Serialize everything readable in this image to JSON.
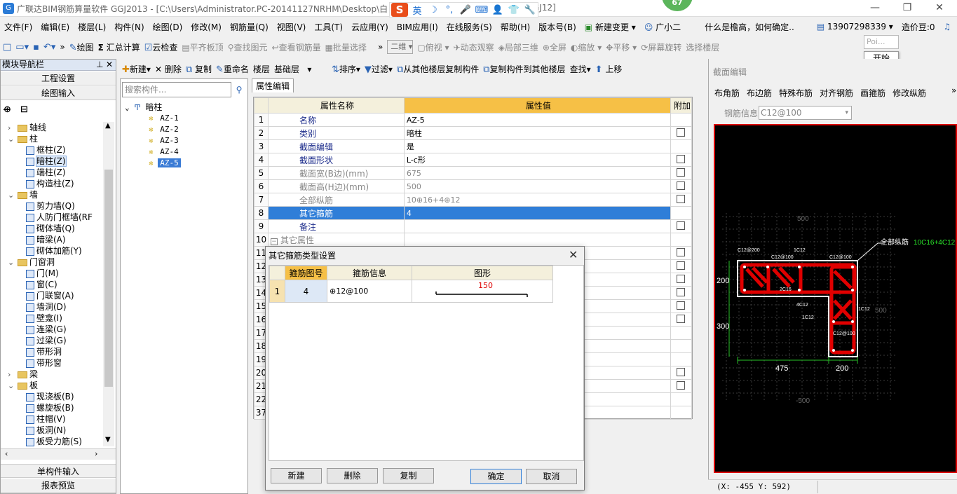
{
  "window": {
    "title": "广联达BIM钢筋算量软件 GGJ2013 - [C:\\Users\\Administrator.PC-20141127NRHM\\Desktop\\白",
    "title_suffix": "GJ12]",
    "badge": "67",
    "minimize": "—",
    "maximize": "❐",
    "close": "✕"
  },
  "ime": {
    "logo": "S",
    "mode": "英",
    "icons": [
      "☽",
      "°,",
      "🎤",
      "⌨",
      "👤",
      "👕",
      "🔧"
    ]
  },
  "menu": {
    "items": [
      "文件(F)",
      "编辑(E)",
      "楼层(L)",
      "构件(N)",
      "绘图(D)",
      "修改(M)",
      "钢筋量(Q)",
      "视图(V)",
      "工具(T)",
      "云应用(Y)",
      "BIM应用(I)",
      "在线服务(S)",
      "帮助(H)",
      "版本号(B)"
    ],
    "change": "新建变更",
    "assistant": "广小二",
    "question": "什么是檐高，如何确定..",
    "phone": "13907298339",
    "coin": "造价豆:0"
  },
  "toolbar": {
    "items": [
      "绘图",
      "汇总计算",
      "云检查",
      "平齐板顶",
      "查找图元",
      "查看钢筋量",
      "批量选择"
    ],
    "view_mode": "二维",
    "right_items": [
      "俯视",
      "动态观察",
      "局部三维",
      "全屏",
      "缩放",
      "平移",
      "屏幕旋转",
      "选择楼层"
    ],
    "popup_top": "Poi...",
    "popup": "开始"
  },
  "nav": {
    "header": "模块导航栏",
    "buttons": [
      "工程设置",
      "绘图输入"
    ],
    "bottom_buttons": [
      "单构件输入",
      "报表预览"
    ],
    "tree": [
      {
        "label": "轴线",
        "level": 1,
        "type": "folder",
        "exp": "›"
      },
      {
        "label": "柱",
        "level": 1,
        "type": "folder",
        "exp": "⌄"
      },
      {
        "label": "框柱(Z)",
        "level": 2,
        "type": "leaf"
      },
      {
        "label": "暗柱(Z)",
        "level": 2,
        "type": "leaf",
        "selected": true
      },
      {
        "label": "端柱(Z)",
        "level": 2,
        "type": "leaf"
      },
      {
        "label": "构造柱(Z)",
        "level": 2,
        "type": "leaf"
      },
      {
        "label": "墙",
        "level": 1,
        "type": "folder",
        "exp": "⌄"
      },
      {
        "label": "剪力墙(Q)",
        "level": 2,
        "type": "leaf"
      },
      {
        "label": "人防门框墙(RF",
        "level": 2,
        "type": "leaf"
      },
      {
        "label": "砌体墙(Q)",
        "level": 2,
        "type": "leaf"
      },
      {
        "label": "暗梁(A)",
        "level": 2,
        "type": "leaf"
      },
      {
        "label": "砌体加筋(Y)",
        "level": 2,
        "type": "leaf"
      },
      {
        "label": "门窗洞",
        "level": 1,
        "type": "folder",
        "exp": "⌄"
      },
      {
        "label": "门(M)",
        "level": 2,
        "type": "leaf"
      },
      {
        "label": "窗(C)",
        "level": 2,
        "type": "leaf"
      },
      {
        "label": "门联窗(A)",
        "level": 2,
        "type": "leaf"
      },
      {
        "label": "墙洞(D)",
        "level": 2,
        "type": "leaf"
      },
      {
        "label": "壁龛(I)",
        "level": 2,
        "type": "leaf"
      },
      {
        "label": "连梁(G)",
        "level": 2,
        "type": "leaf"
      },
      {
        "label": "过梁(G)",
        "level": 2,
        "type": "leaf"
      },
      {
        "label": "带形洞",
        "level": 2,
        "type": "leaf"
      },
      {
        "label": "带形窗",
        "level": 2,
        "type": "leaf"
      },
      {
        "label": "梁",
        "level": 1,
        "type": "folder",
        "exp": "›"
      },
      {
        "label": "板",
        "level": 1,
        "type": "folder",
        "exp": "⌄"
      },
      {
        "label": "现浇板(B)",
        "level": 2,
        "type": "leaf"
      },
      {
        "label": "螺旋板(B)",
        "level": 2,
        "type": "leaf"
      },
      {
        "label": "柱帽(V)",
        "level": 2,
        "type": "leaf"
      },
      {
        "label": "板洞(N)",
        "level": 2,
        "type": "leaf"
      },
      {
        "label": "板受力筋(S)",
        "level": 2,
        "type": "leaf"
      }
    ]
  },
  "comp_toolbar": {
    "items": [
      "新建",
      "删除",
      "复制",
      "重命名",
      "楼层",
      "基础层",
      "排序",
      "过滤",
      "从其他楼层复制构件",
      "复制构件到其他楼层",
      "查找",
      "上移"
    ]
  },
  "comp_list": {
    "search_placeholder": "搜索构件...",
    "root": "暗柱",
    "items": [
      "AZ-1",
      "AZ-2",
      "AZ-3",
      "AZ-4",
      "AZ-5"
    ],
    "selected": "AZ-5"
  },
  "props": {
    "tab": "属性编辑",
    "headers": [
      "属性名称",
      "属性值",
      "附加"
    ],
    "rows": [
      {
        "n": "1",
        "name": "名称",
        "value": "AZ-5",
        "cb": false
      },
      {
        "n": "2",
        "name": "类别",
        "value": "暗柱",
        "cb": true
      },
      {
        "n": "3",
        "name": "截面编辑",
        "value": "是",
        "cb": false
      },
      {
        "n": "4",
        "name": "截面形状",
        "value": "L-c形",
        "cb": true
      },
      {
        "n": "5",
        "name": "截面宽(B边)(mm)",
        "value": "675",
        "cb": true,
        "gray": true
      },
      {
        "n": "6",
        "name": "截面高(H边)(mm)",
        "value": "500",
        "cb": true,
        "gray": true
      },
      {
        "n": "7",
        "name": "全部纵筋",
        "value": "10⊕16+4⊕12",
        "cb": true,
        "gray": true
      },
      {
        "n": "8",
        "name": "其它箍筋",
        "value": "4",
        "cb": false,
        "selected": true
      },
      {
        "n": "9",
        "name": "备注",
        "value": "",
        "cb": true
      },
      {
        "n": "10",
        "name": "其它属性",
        "value": "",
        "cb": false,
        "group": true
      },
      {
        "n": "11",
        "name": "",
        "value": "",
        "cb": true
      },
      {
        "n": "12",
        "name": "",
        "value": "",
        "cb": true
      },
      {
        "n": "13",
        "name": "",
        "value": "",
        "cb": true
      },
      {
        "n": "14",
        "name": "",
        "value": "",
        "cb": true
      },
      {
        "n": "15",
        "name": "",
        "value": "",
        "cb": true
      },
      {
        "n": "16",
        "name": "",
        "value": "",
        "cb": true
      },
      {
        "n": "17",
        "name": "",
        "value": "",
        "cb": false
      },
      {
        "n": "18",
        "name": "",
        "value": "",
        "cb": false
      },
      {
        "n": "19",
        "name": "",
        "value": "",
        "cb": false
      },
      {
        "n": "20",
        "name": "",
        "value": "",
        "cb": true
      },
      {
        "n": "21",
        "name": "",
        "value": "",
        "cb": true
      },
      {
        "n": "22",
        "name": "",
        "value": "",
        "cb": false
      },
      {
        "n": "37",
        "name": "",
        "value": "",
        "cb": false
      }
    ]
  },
  "dialog": {
    "title": "其它箍筋类型设置",
    "headers": [
      "箍筋图号",
      "箍筋信息",
      "图形"
    ],
    "rows": [
      {
        "n": "1",
        "code": "4",
        "info": "⊕12@100",
        "shape_value": "150"
      }
    ],
    "buttons": {
      "new": "新建",
      "delete": "删除",
      "copy": "复制",
      "ok": "确定",
      "cancel": "取消"
    }
  },
  "section": {
    "title": "截面编辑",
    "tools": [
      "布角筋",
      "布边筋",
      "特殊布筋",
      "对齐钢筋",
      "画箍筋",
      "修改纵筋"
    ],
    "rebar_label": "钢筋信息",
    "rebar_value": "C12@100",
    "callout_label": "全部纵筋",
    "callout_value": "10C16+4C12",
    "labels": {
      "top500": "500",
      "bottom500": "-500",
      "right500": "500",
      "dim200": "200",
      "dim300": "300",
      "dim475": "475",
      "dim200b": "200"
    },
    "bar_tags": [
      "C12@200",
      "C12@100",
      "1C12",
      "C12@100",
      "2C16",
      "4C12",
      "1C12",
      "1C12",
      "C12@100"
    ],
    "status": "(X: -455 Y: 592)"
  }
}
